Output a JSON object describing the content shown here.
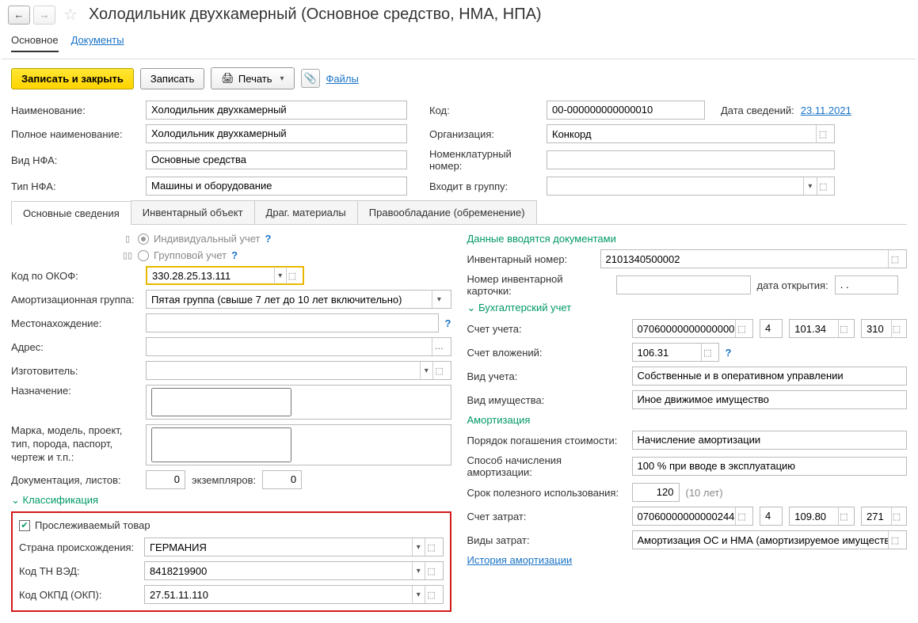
{
  "header": {
    "title": "Холодильник двухкамерный (Основное средство, НМА, НПА)"
  },
  "topTabs": {
    "main": "Основное",
    "documents": "Документы"
  },
  "actions": {
    "saveClose": "Записать и закрыть",
    "save": "Записать",
    "print": "Печать",
    "files": "Файлы"
  },
  "labels": {
    "name": "Наименование:",
    "fullName": "Полное наименование:",
    "nfaType": "Вид НФА:",
    "nfaKind": "Тип НФА:",
    "code": "Код:",
    "dateInfo": "Дата сведений:",
    "org": "Организация:",
    "nomNum": "Номенклатурный номер:",
    "inGroup": "Входит в группу:",
    "individualAcc": "Индивидуальный учет",
    "groupAcc": "Групповой учет",
    "okof": "Код по ОКОФ:",
    "amortGroup": "Амортизационная группа:",
    "location": "Местонахождение:",
    "address": "Адрес:",
    "maker": "Изготовитель:",
    "purpose": "Назначение:",
    "brand": "Марка, модель, проект, тип, порода, паспорт, чертеж и т.п.:",
    "docs": "Документация, листов:",
    "copies": "экземпляров:",
    "classification": "Классификация",
    "tracked": "Прослеживаемый товар",
    "country": "Страна происхождения:",
    "tnved": "Код ТН ВЭД:",
    "okpd": "Код ОКПД (ОКП):",
    "enteredByDocs": "Данные вводятся документами",
    "invNum": "Инвентарный номер:",
    "invCardNum": "Номер инвентарной карточки:",
    "openDate": "дата открытия:",
    "accounting": "Бухгалтерский учет",
    "account": "Счет учета:",
    "investAccount": "Счет вложений:",
    "accType": "Вид учета:",
    "propType": "Вид имущества:",
    "amort": "Амортизация",
    "repayOrder": "Порядок погашения стоимости:",
    "amortMethod": "Способ начисления амортизации:",
    "usefulLife": "Срок полезного использования:",
    "expenseAccount": "Счет затрат:",
    "expenseType": "Виды затрат:",
    "amortHistory": "История амортизации"
  },
  "values": {
    "name": "Холодильник двухкамерный",
    "fullName": "Холодильник двухкамерный",
    "nfaType": "Основные средства",
    "nfaKind": "Машины и оборудование",
    "code": "00-000000000000010",
    "dateInfo": "23.11.2021",
    "org": "Конкорд",
    "okof": "330.28.25.13.111",
    "amortGroup": "Пятая группа (свыше 7 лет до 10 лет включительно)",
    "docs": "0",
    "copies": "0",
    "country": "ГЕРМАНИЯ",
    "tnved": "8418219900",
    "okpd": "27.51.11.110",
    "invNum": "2101340500002",
    "openDate": ". .",
    "invCardNum": "",
    "account": "07060000000000000",
    "accountSeg2": "4",
    "accountSeg3": "101.34",
    "accountSeg4": "310",
    "investAccount": "106.31",
    "accType": "Собственные и в оперативном управлении",
    "propType": "Иное движимое имущество",
    "repayOrder": "Начисление амортизации",
    "amortMethod": "100 % при вводе в эксплуатацию",
    "usefulLife": "120",
    "usefulLifeYears": "(10 лет)",
    "expenseAccount": "07060000000000244",
    "expenseSeg2": "4",
    "expenseSeg3": "109.80",
    "expenseSeg4": "271",
    "expenseType": "Амортизация ОС и НМА (амортизируемое имущество)"
  },
  "sectionTabs": {
    "main": "Основные сведения",
    "inv": "Инвентарный объект",
    "metals": "Драг. материалы",
    "rights": "Правообладание (обременение)"
  }
}
